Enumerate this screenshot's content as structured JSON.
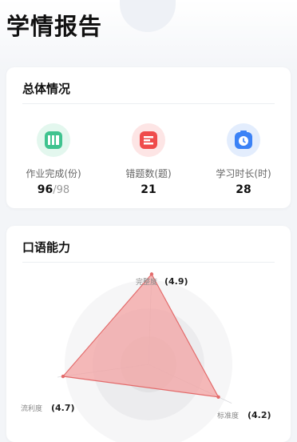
{
  "page": {
    "title": "学情报告"
  },
  "overview": {
    "title": "总体情况",
    "stats": [
      {
        "label": "作业完成(份)",
        "value": "96",
        "total": "/98",
        "icon": "books-icon",
        "color": "#3fc38f"
      },
      {
        "label": "错题数(题)",
        "value": "21",
        "total": "",
        "icon": "wrong-note-icon",
        "color": "#ef4b4b"
      },
      {
        "label": "学习时长(时)",
        "value": "28",
        "total": "",
        "icon": "timer-icon",
        "color": "#3b82f6"
      }
    ]
  },
  "speaking": {
    "title": "口语能力",
    "dimensions": [
      {
        "name": "完整度",
        "score": "(4.9)",
        "value": 4.9
      },
      {
        "name": "标准度",
        "score": "(4.2)",
        "value": 4.2
      },
      {
        "name": "流利度",
        "score": "(4.7)",
        "value": 4.7
      }
    ],
    "max": 5,
    "fill_color": "#f3a3a3",
    "stroke_color": "#e36b6b"
  }
}
